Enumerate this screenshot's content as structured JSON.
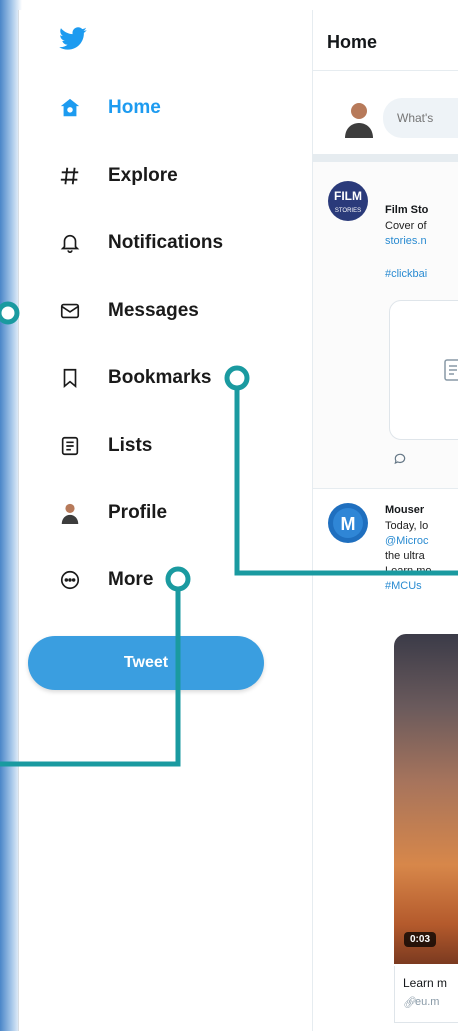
{
  "sidebar": {
    "items": [
      {
        "label": "Home",
        "icon": "home-icon"
      },
      {
        "label": "Explore",
        "icon": "hashtag-icon"
      },
      {
        "label": "Notifications",
        "icon": "bell-icon"
      },
      {
        "label": "Messages",
        "icon": "envelope-icon"
      },
      {
        "label": "Bookmarks",
        "icon": "bookmark-icon"
      },
      {
        "label": "Lists",
        "icon": "list-icon"
      },
      {
        "label": "Profile",
        "icon": "profile-avatar-icon"
      },
      {
        "label": "More",
        "icon": "more-circle-icon"
      }
    ],
    "tweet_button": "Tweet"
  },
  "main": {
    "title": "Home",
    "compose_placeholder": "What's",
    "tweets": [
      {
        "name": "Film Sto",
        "line1": "Cover of",
        "link": "stories.n",
        "hashtag": "#clickbai"
      },
      {
        "name": "Mouser",
        "line1": "Today, lo",
        "mention": "@Microc",
        "line2": "the ultra",
        "line3": "Learn mo",
        "hashtag": "#MCUs",
        "video_time": "0:03",
        "caption": "Learn m",
        "caption_link": "eu.m"
      }
    ]
  },
  "colors": {
    "accent": "#1d9bf0",
    "callout": "#1a9aa0",
    "tweet_button": "#3a9ee0"
  }
}
